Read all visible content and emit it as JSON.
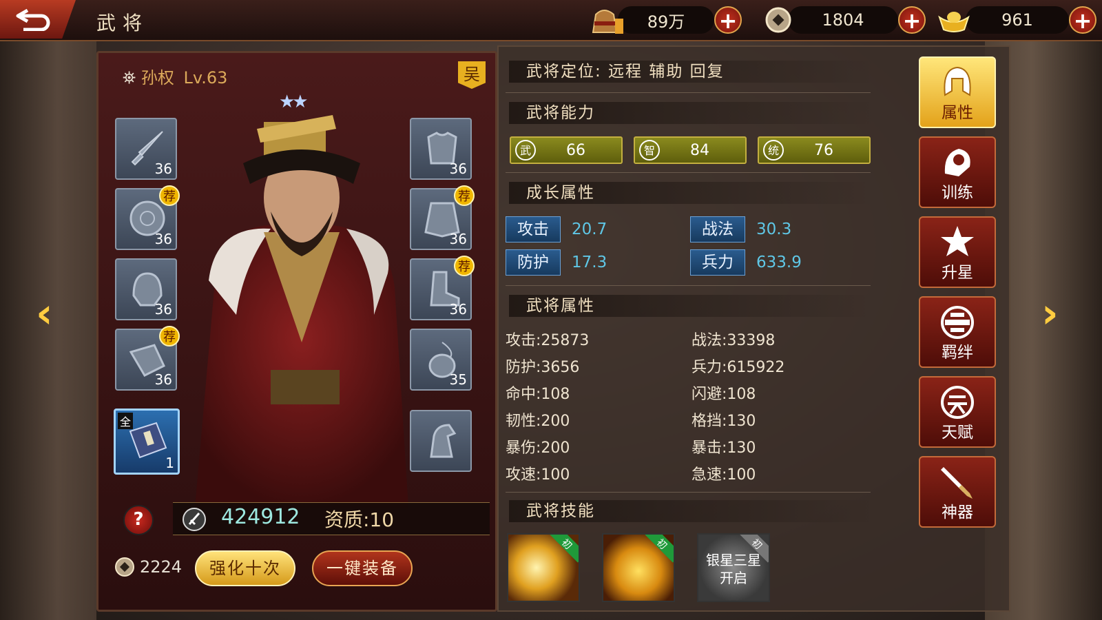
{
  "header": {
    "title": "武将",
    "resources": [
      {
        "icon": "food-icon",
        "value": "89万"
      },
      {
        "icon": "coin-icon",
        "value": "1804"
      },
      {
        "icon": "gold-ingot-icon",
        "value": "961"
      }
    ]
  },
  "hero": {
    "name": "孙权",
    "level": "Lv.63",
    "faction": "吴",
    "stars": "★★",
    "equipment_left": [
      {
        "icon": "sword-icon",
        "level": "36",
        "recommended": false
      },
      {
        "icon": "shield-icon",
        "level": "36",
        "recommended": true
      },
      {
        "icon": "helmet-icon",
        "level": "36",
        "recommended": false
      },
      {
        "icon": "gauntlet-icon",
        "level": "36",
        "recommended": true
      }
    ],
    "equipment_right": [
      {
        "icon": "armor-icon",
        "level": "36",
        "recommended": false
      },
      {
        "icon": "skirt-armor-icon",
        "level": "36",
        "recommended": true
      },
      {
        "icon": "boots-icon",
        "level": "36",
        "recommended": true
      },
      {
        "icon": "pendant-icon",
        "level": "35",
        "recommended": false
      }
    ],
    "recommend_badge": "荐",
    "book_slot": {
      "badge": "全",
      "count": "1"
    },
    "power": "424912",
    "quality": "资质:10",
    "upgrade_cost": "2224",
    "buttons": {
      "upgrade_ten": "强化十次",
      "auto_equip": "一键装备"
    }
  },
  "info": {
    "role_line": "武将定位: 远程 辅助 回复",
    "ability_title": "武将能力",
    "abilities": [
      {
        "icon": "武",
        "value": "66"
      },
      {
        "icon": "智",
        "value": "84"
      },
      {
        "icon": "统",
        "value": "76"
      }
    ],
    "growth_title": "成长属性",
    "growth": [
      {
        "label": "攻击",
        "value": "20.7"
      },
      {
        "label": "战法",
        "value": "30.3"
      },
      {
        "label": "防护",
        "value": "17.3"
      },
      {
        "label": "兵力",
        "value": "633.9"
      }
    ],
    "attr_title": "武将属性",
    "attrs_left": [
      "攻击:25873",
      "防护:3656",
      "命中:108",
      "韧性:200",
      "暴伤:200",
      "攻速:100"
    ],
    "attrs_right": [
      "战法:33398",
      "兵力:615922",
      "闪避:108",
      "格挡:130",
      "暴击:130",
      "急速:100"
    ],
    "skill_title": "武将技能",
    "skills": [
      {
        "badge": "初",
        "text": ""
      },
      {
        "badge": "初",
        "text": ""
      },
      {
        "badge": "初",
        "text": "银星三星开启"
      }
    ]
  },
  "tabs": [
    {
      "label": "属性",
      "icon": "helmet-icon",
      "active": true
    },
    {
      "label": "训练",
      "icon": "training-icon",
      "active": false
    },
    {
      "label": "升星",
      "icon": "star-up-icon",
      "active": false
    },
    {
      "label": "羁绊",
      "icon": "bond-icon",
      "active": false
    },
    {
      "label": "天赋",
      "icon": "talent-icon",
      "active": false
    },
    {
      "label": "神器",
      "icon": "artifact-icon",
      "active": false
    }
  ],
  "colors": {
    "accent_gold": "#f0b600",
    "growth_value": "#5fc7e6",
    "ability_bar": "#8a8a1e"
  }
}
